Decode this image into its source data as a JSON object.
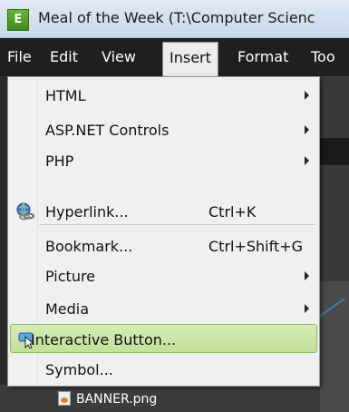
{
  "window": {
    "title": "Meal of the Week (T:\\Computer Scienc",
    "app_icon": "expression-web-icon"
  },
  "menubar": {
    "items": [
      {
        "label": "File"
      },
      {
        "label": "Edit"
      },
      {
        "label": "View"
      },
      {
        "label": "Insert",
        "active": true
      },
      {
        "label": "Format"
      },
      {
        "label": "Too"
      }
    ]
  },
  "insert_menu": {
    "items": [
      {
        "label": "HTML",
        "submenu": true
      },
      {
        "label": "ASP.NET Controls",
        "submenu": true
      },
      {
        "label": "PHP",
        "submenu": true
      },
      {
        "label": "Hyperlink...",
        "shortcut": "Ctrl+K",
        "icon": "hyperlink-globe-icon"
      },
      {
        "label": "Bookmark...",
        "shortcut": "Ctrl+Shift+G"
      },
      {
        "label": "Picture",
        "submenu": true
      },
      {
        "label": "Media",
        "submenu": true
      },
      {
        "label": "Interactive Button...",
        "icon": "interactive-button-icon",
        "highlighted": true
      },
      {
        "label": "Symbol..."
      }
    ]
  },
  "background": {
    "file_label": "BANNER.png",
    "highlight_color": "#c2e09a",
    "accent_color": "#2c7fbf"
  }
}
